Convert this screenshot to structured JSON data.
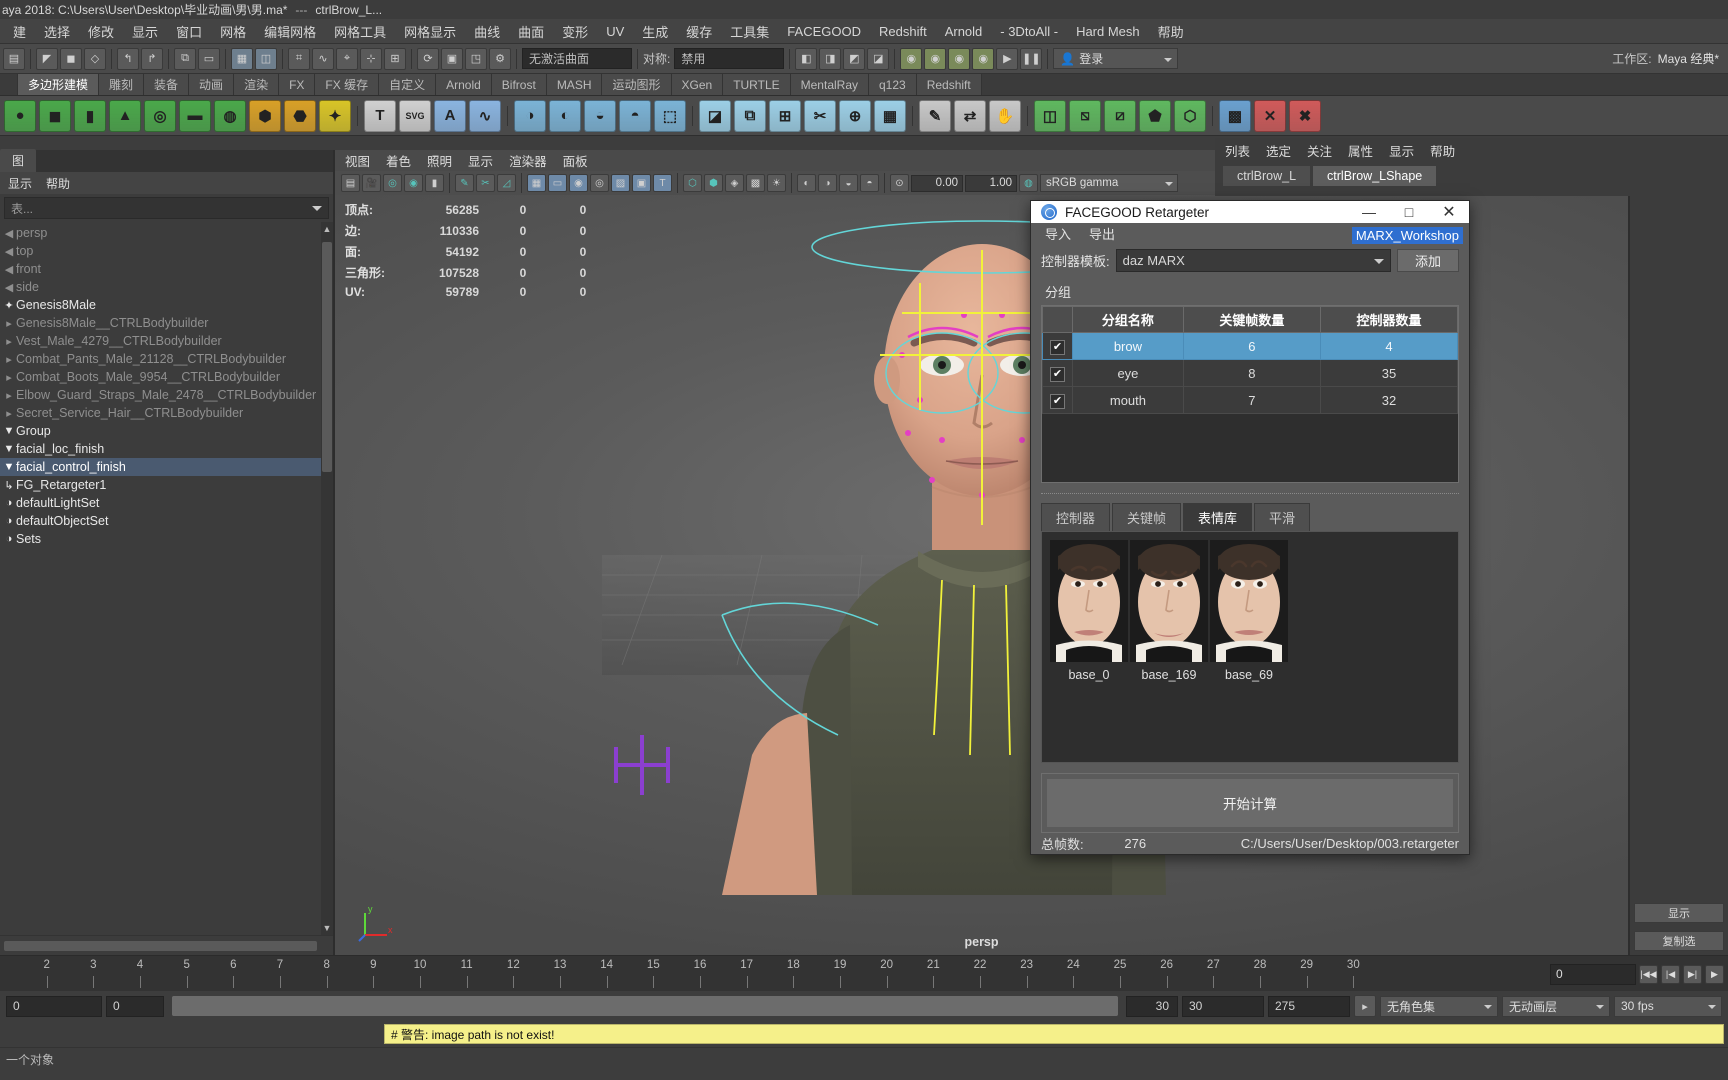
{
  "titlebar": {
    "text": "aya 2018: C:\\Users\\User\\Desktop\\毕业动画\\男\\男.ma*",
    "sep": "---",
    "node": "ctrlBrow_L..."
  },
  "menubar": {
    "items": [
      "建",
      "选择",
      "修改",
      "显示",
      "窗口",
      "网格",
      "编辑网格",
      "网格工具",
      "网格显示",
      "曲线",
      "曲面",
      "变形",
      "UV",
      "生成",
      "缓存",
      "工具集",
      "FACEGOOD",
      "Redshift",
      "Arnold",
      "- 3DtoAll -",
      "Hard Mesh",
      "帮助"
    ]
  },
  "statusline": {
    "icons": [
      "▤",
      "▣",
      "▦",
      "↰",
      "↱",
      "▭",
      "◫",
      "▥",
      "◨",
      "◩",
      "⬒",
      "⬓",
      "⬕",
      "⬔",
      "◰",
      "◱",
      "◲",
      "◳",
      "?"
    ],
    "no_active_curve": "无激活曲面",
    "symmetry_label": "对称:",
    "symmetry_value": "禁用",
    "snap_icons": [
      "⌖",
      "⌗",
      "⊹",
      "✥",
      "◎",
      "◉",
      "◍",
      "◌",
      "⬤",
      "▶",
      "⏸"
    ],
    "login_label": "登录",
    "workspace_label": "工作区:",
    "workspace_value": "Maya 经典*"
  },
  "shelf": {
    "tabs": [
      "多边形建模",
      "雕刻",
      "装备",
      "动画",
      "渲染",
      "FX",
      "FX 缓存",
      "自定义",
      "Arnold",
      "Bifrost",
      "MASH",
      "运动图形",
      "XGen",
      "TURTLE",
      "MentalRay",
      "q123",
      "Redshift"
    ],
    "active_tab": "多边形建模",
    "icons": [
      {
        "name": "sphere-icon",
        "glyph": "●",
        "color": "#4aa84a"
      },
      {
        "name": "cube-icon",
        "glyph": "◼",
        "color": "#4aa84a"
      },
      {
        "name": "cylinder-icon",
        "glyph": "▮",
        "color": "#4aa84a"
      },
      {
        "name": "cone-icon",
        "glyph": "▲",
        "color": "#4aa84a"
      },
      {
        "name": "torus-icon",
        "glyph": "◎",
        "color": "#4aa84a"
      },
      {
        "name": "plane-icon",
        "glyph": "▬",
        "color": "#4aa84a"
      },
      {
        "name": "disc-icon",
        "glyph": "◍",
        "color": "#4aa84a"
      },
      {
        "name": "platonic-icon",
        "glyph": "⬢",
        "color": "#d8a027"
      },
      {
        "name": "soccer-icon",
        "glyph": "⬣",
        "color": "#d8a027"
      },
      {
        "name": "star-icon",
        "glyph": "✦",
        "color": "#d8c427"
      },
      {
        "name": "text-icon",
        "glyph": "T",
        "color": "#d0d0d0"
      },
      {
        "name": "svg-icon",
        "glyph": "SVG",
        "color": "#d0d0d0"
      },
      {
        "name": "type-icon",
        "glyph": "A",
        "color": "#8ab4e0"
      },
      {
        "name": "sweep-icon",
        "glyph": "∿",
        "color": "#8ab4e0"
      },
      {
        "name": "boolean-icon",
        "glyph": "◑",
        "color": "#7bb3d6"
      },
      {
        "name": "combine-icon",
        "glyph": "◐",
        "color": "#7bb3d6"
      },
      {
        "name": "separate-icon",
        "glyph": "◒",
        "color": "#7bb3d6"
      },
      {
        "name": "smooth-icon",
        "glyph": "◓",
        "color": "#7bb3d6"
      },
      {
        "name": "extrude-icon",
        "glyph": "⬚",
        "color": "#7bb3d6"
      },
      {
        "name": "bevel-icon",
        "glyph": "◪",
        "color": "#9ccfe6"
      },
      {
        "name": "bridge-icon",
        "glyph": "⧉",
        "color": "#9ccfe6"
      },
      {
        "name": "merge-icon",
        "glyph": "⊞",
        "color": "#9ccfe6"
      },
      {
        "name": "multicut-icon",
        "glyph": "✂",
        "color": "#9ccfe6"
      },
      {
        "name": "target-weld-icon",
        "glyph": "⊕",
        "color": "#9ccfe6"
      },
      {
        "name": "quad-draw-icon",
        "glyph": "▦",
        "color": "#9ccfe6"
      },
      {
        "name": "sculpt-icon",
        "glyph": "✎",
        "color": "#c8c8c8"
      },
      {
        "name": "slide-icon",
        "glyph": "⇄",
        "color": "#c8c8c8"
      },
      {
        "name": "grab-icon",
        "glyph": "✋",
        "color": "#c8c8c8"
      },
      {
        "name": "mirror-icon",
        "glyph": "◫",
        "color": "#5fb85f"
      },
      {
        "name": "duplicate-icon",
        "glyph": "⧅",
        "color": "#5fb85f"
      },
      {
        "name": "symmetry-icon",
        "glyph": "⧄",
        "color": "#5fb85f"
      },
      {
        "name": "cut-icon",
        "glyph": "⬟",
        "color": "#5fb85f"
      },
      {
        "name": "unfold-icon",
        "glyph": "⬡",
        "color": "#5fb85f"
      },
      {
        "name": "uv-editor-icon",
        "glyph": "▩",
        "color": "#6aa0cf"
      },
      {
        "name": "transfer-icon",
        "glyph": "✕",
        "color": "#d05a5a"
      },
      {
        "name": "paint-weights-icon",
        "glyph": "✖",
        "color": "#d05a5a"
      }
    ]
  },
  "outliner": {
    "tab_label": "图",
    "menu": [
      "显示",
      "帮助"
    ],
    "filter_placeholder": "表...",
    "items": [
      {
        "label": "persp",
        "glyph": "◀",
        "style": "dim"
      },
      {
        "label": "top",
        "glyph": "◀",
        "style": "dim"
      },
      {
        "label": "front",
        "glyph": "◀",
        "style": "dim"
      },
      {
        "label": "side",
        "glyph": "◀",
        "style": "dim"
      },
      {
        "label": "Genesis8Male",
        "glyph": "✦",
        "style": "bright"
      },
      {
        "label": "Genesis8Male__CTRLBodybuilder",
        "glyph": "▸",
        "style": "dim"
      },
      {
        "label": "Vest_Male_4279__CTRLBodybuilder",
        "glyph": "▸",
        "style": "dim"
      },
      {
        "label": "Combat_Pants_Male_21128__CTRLBodybuilder",
        "glyph": "▸",
        "style": "dim"
      },
      {
        "label": "Combat_Boots_Male_9954__CTRLBodybuilder",
        "glyph": "▸",
        "style": "dim"
      },
      {
        "label": "Elbow_Guard_Straps_Male_2478__CTRLBodybuilder",
        "glyph": "▸",
        "style": "dim"
      },
      {
        "label": "Secret_Service_Hair__CTRLBodybuilder",
        "glyph": "▸",
        "style": "dim"
      },
      {
        "label": "Group",
        "glyph": "▼",
        "style": "bright"
      },
      {
        "label": "facial_loc_finish",
        "glyph": "▼",
        "style": "bright"
      },
      {
        "label": "facial_control_finish",
        "glyph": "▼",
        "style": "sel"
      },
      {
        "label": "FG_Retargeter1",
        "glyph": "↳",
        "style": "bright"
      },
      {
        "label": "defaultLightSet",
        "glyph": "◑",
        "style": "bright"
      },
      {
        "label": "defaultObjectSet",
        "glyph": "◑",
        "style": "bright"
      },
      {
        "label": "Sets",
        "glyph": "◑",
        "style": "bright"
      }
    ]
  },
  "viewport": {
    "menu": [
      "视图",
      "着色",
      "照明",
      "显示",
      "渲染器",
      "面板"
    ],
    "num1": "0.00",
    "num2": "1.00",
    "gamma": "sRGB gamma",
    "hud": {
      "rows": [
        {
          "label": "顶点:",
          "v1": "56285",
          "v2": "0",
          "v3": "0"
        },
        {
          "label": "边:",
          "v1": "110336",
          "v2": "0",
          "v3": "0"
        },
        {
          "label": "面:",
          "v1": "54192",
          "v2": "0",
          "v3": "0"
        },
        {
          "label": "三角形:",
          "v1": "107528",
          "v2": "0",
          "v3": "0"
        },
        {
          "label": "UV:",
          "v1": "59789",
          "v2": "0",
          "v3": "0"
        }
      ]
    },
    "camera_label": "persp",
    "axis_x": "x",
    "axis_y": "y"
  },
  "rightpanel": {
    "menu": [
      "列表",
      "选定",
      "关注",
      "属性",
      "显示",
      "帮助"
    ],
    "tabs": [
      "ctrlBrow_L",
      "ctrlBrow_LShape"
    ],
    "active_tab": "ctrlBrow_LShape",
    "side_buttons": [
      "显示",
      "复制选"
    ]
  },
  "dialog": {
    "title": "FACEGOOD Retargeter",
    "window_buttons": {
      "minimize": "—",
      "maximize": "□",
      "close": "✕"
    },
    "menu": [
      "导入",
      "导出"
    ],
    "workshop_badge": "MARX_Workshop",
    "template_label": "控制器模板:",
    "template_value": "daz MARX",
    "add_button": "添加",
    "group_label": "分组",
    "table": {
      "headers": [
        "",
        "分组名称",
        "关键帧数量",
        "控制器数量"
      ],
      "rows": [
        {
          "checked": true,
          "name": "brow",
          "keyframes": "6",
          "controllers": "4",
          "selected": true
        },
        {
          "checked": true,
          "name": "eye",
          "keyframes": "8",
          "controllers": "35",
          "selected": false
        },
        {
          "checked": true,
          "name": "mouth",
          "keyframes": "7",
          "controllers": "32",
          "selected": false
        }
      ]
    },
    "tabs": [
      "控制器",
      "关键帧",
      "表情库",
      "平滑"
    ],
    "active_tab": "表情库",
    "gallery": [
      {
        "caption": "base_0"
      },
      {
        "caption": "base_169"
      },
      {
        "caption": "base_69"
      }
    ],
    "calc_button": "开始计算",
    "footer": {
      "total_label": "总帧数:",
      "total_value": "276",
      "path": "C:/Users/User/Desktop/003.retargeter"
    }
  },
  "timeline": {
    "ticks": [
      "2",
      "3",
      "4",
      "5",
      "6",
      "7",
      "8",
      "9",
      "10",
      "11",
      "12",
      "13",
      "14",
      "15",
      "16",
      "17",
      "18",
      "19",
      "20",
      "21",
      "22",
      "23",
      "24",
      "25",
      "26",
      "27",
      "28",
      "29",
      "30"
    ],
    "current_frame": "0",
    "transport_icons": [
      "|◀◀",
      "|◀",
      "◀|",
      "▶"
    ]
  },
  "rangebar": {
    "start": "0",
    "anim_start": "0",
    "anim_end": "30",
    "range_start": "30",
    "range_end": "275",
    "character_set": "无角色集",
    "anim_layer": "无动画层",
    "fps": "30 fps"
  },
  "command": {
    "warning": "# 警告: image path is not exist!",
    "status": "一个对象"
  }
}
